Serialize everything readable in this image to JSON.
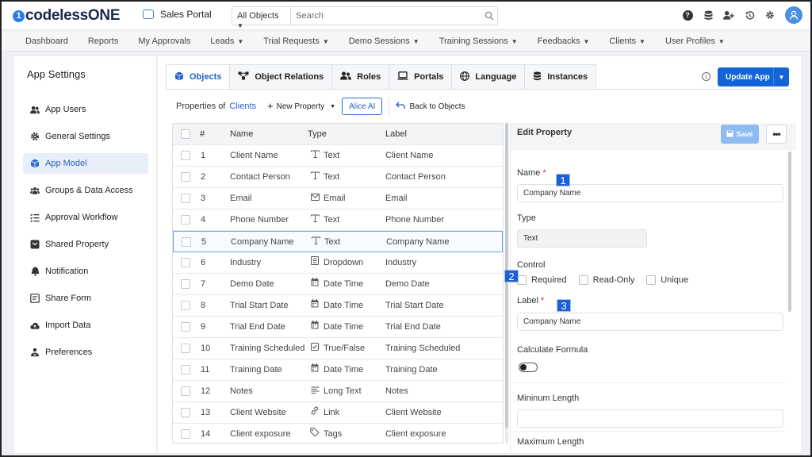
{
  "header": {
    "logo_mark": "1",
    "logo_text": "codelessONE",
    "app_name": "Sales Portal",
    "search_scope": "All Objects",
    "search_placeholder": "Search"
  },
  "icons": {
    "help": "?"
  },
  "nav": [
    {
      "label": "Dashboard",
      "caret": false
    },
    {
      "label": "Reports",
      "caret": false
    },
    {
      "label": "My Approvals",
      "caret": false
    },
    {
      "label": "Leads",
      "caret": true
    },
    {
      "label": "Trial Requests",
      "caret": true
    },
    {
      "label": "Demo Sessions",
      "caret": true
    },
    {
      "label": "Training Sessions",
      "caret": true
    },
    {
      "label": "Feedbacks",
      "caret": true
    },
    {
      "label": "Clients",
      "caret": true
    },
    {
      "label": "User Profiles",
      "caret": true
    }
  ],
  "sidebar": {
    "title": "App Settings",
    "items": [
      {
        "label": "App Users",
        "icon": "users-icon"
      },
      {
        "label": "General Settings",
        "icon": "gear-icon"
      },
      {
        "label": "App Model",
        "icon": "cube-icon"
      },
      {
        "label": "Groups & Data Access",
        "icon": "group-icon"
      },
      {
        "label": "Approval Workflow",
        "icon": "checklist-icon"
      },
      {
        "label": "Shared Property",
        "icon": "shared-icon"
      },
      {
        "label": "Notification",
        "icon": "bell-icon"
      },
      {
        "label": "Share Form",
        "icon": "form-icon"
      },
      {
        "label": "Import Data",
        "icon": "cloud-upload-icon"
      },
      {
        "label": "Preferences",
        "icon": "preferences-icon"
      }
    ],
    "active_index": 2
  },
  "tabs": [
    "Objects",
    "Object Relations",
    "Roles",
    "Portals",
    "Language",
    "Instances"
  ],
  "update_button": "Update App",
  "toolbar": {
    "properties_of": "Properties of",
    "object_name": "Clients",
    "new_property": "New Property",
    "alice_ai": "Alice AI",
    "back": "Back to Objects"
  },
  "table": {
    "columns": [
      "#",
      "Name",
      "Type",
      "Label"
    ],
    "rows": [
      {
        "num": "1",
        "name": "Client Name",
        "type": "Text",
        "label": "Client Name"
      },
      {
        "num": "2",
        "name": "Contact Person",
        "type": "Text",
        "label": "Contact Person"
      },
      {
        "num": "3",
        "name": "Email",
        "type": "Email",
        "label": "Email"
      },
      {
        "num": "4",
        "name": "Phone Number",
        "type": "Text",
        "label": "Phone Number"
      },
      {
        "num": "5",
        "name": "Company Name",
        "type": "Text",
        "label": "Company Name"
      },
      {
        "num": "6",
        "name": "Industry",
        "type": "Dropdown",
        "label": "Industry"
      },
      {
        "num": "7",
        "name": "Demo Date",
        "type": "Date Time",
        "label": "Demo Date"
      },
      {
        "num": "8",
        "name": "Trial Start Date",
        "type": "Date Time",
        "label": "Trial Start Date"
      },
      {
        "num": "9",
        "name": "Trial End Date",
        "type": "Date Time",
        "label": "Trial End Date"
      },
      {
        "num": "10",
        "name": "Training Scheduled",
        "type": "True/False",
        "label": "Training Scheduled"
      },
      {
        "num": "11",
        "name": "Training Date",
        "type": "Date Time",
        "label": "Training Date"
      },
      {
        "num": "12",
        "name": "Notes",
        "type": "Long Text",
        "label": "Notes"
      },
      {
        "num": "13",
        "name": "Client Website",
        "type": "Link",
        "label": "Client Website"
      },
      {
        "num": "14",
        "name": "Client exposure",
        "type": "Tags",
        "label": "Client exposure"
      }
    ],
    "selected_index": 4
  },
  "edit": {
    "title": "Edit Property",
    "save": "Save",
    "name_label": "Name",
    "required_mark": "*",
    "name_value": "Company Name",
    "type_label": "Type",
    "type_value": "Text",
    "control_label": "Control",
    "control_options": [
      "Required",
      "Read-Only",
      "Unique"
    ],
    "label_label": "Label",
    "label_value": "Company Name",
    "formula_label": "Calculate Formula",
    "min_label": "Mininum Length",
    "max_label": "Maximum Length"
  },
  "markers": [
    "1",
    "2",
    "3"
  ]
}
